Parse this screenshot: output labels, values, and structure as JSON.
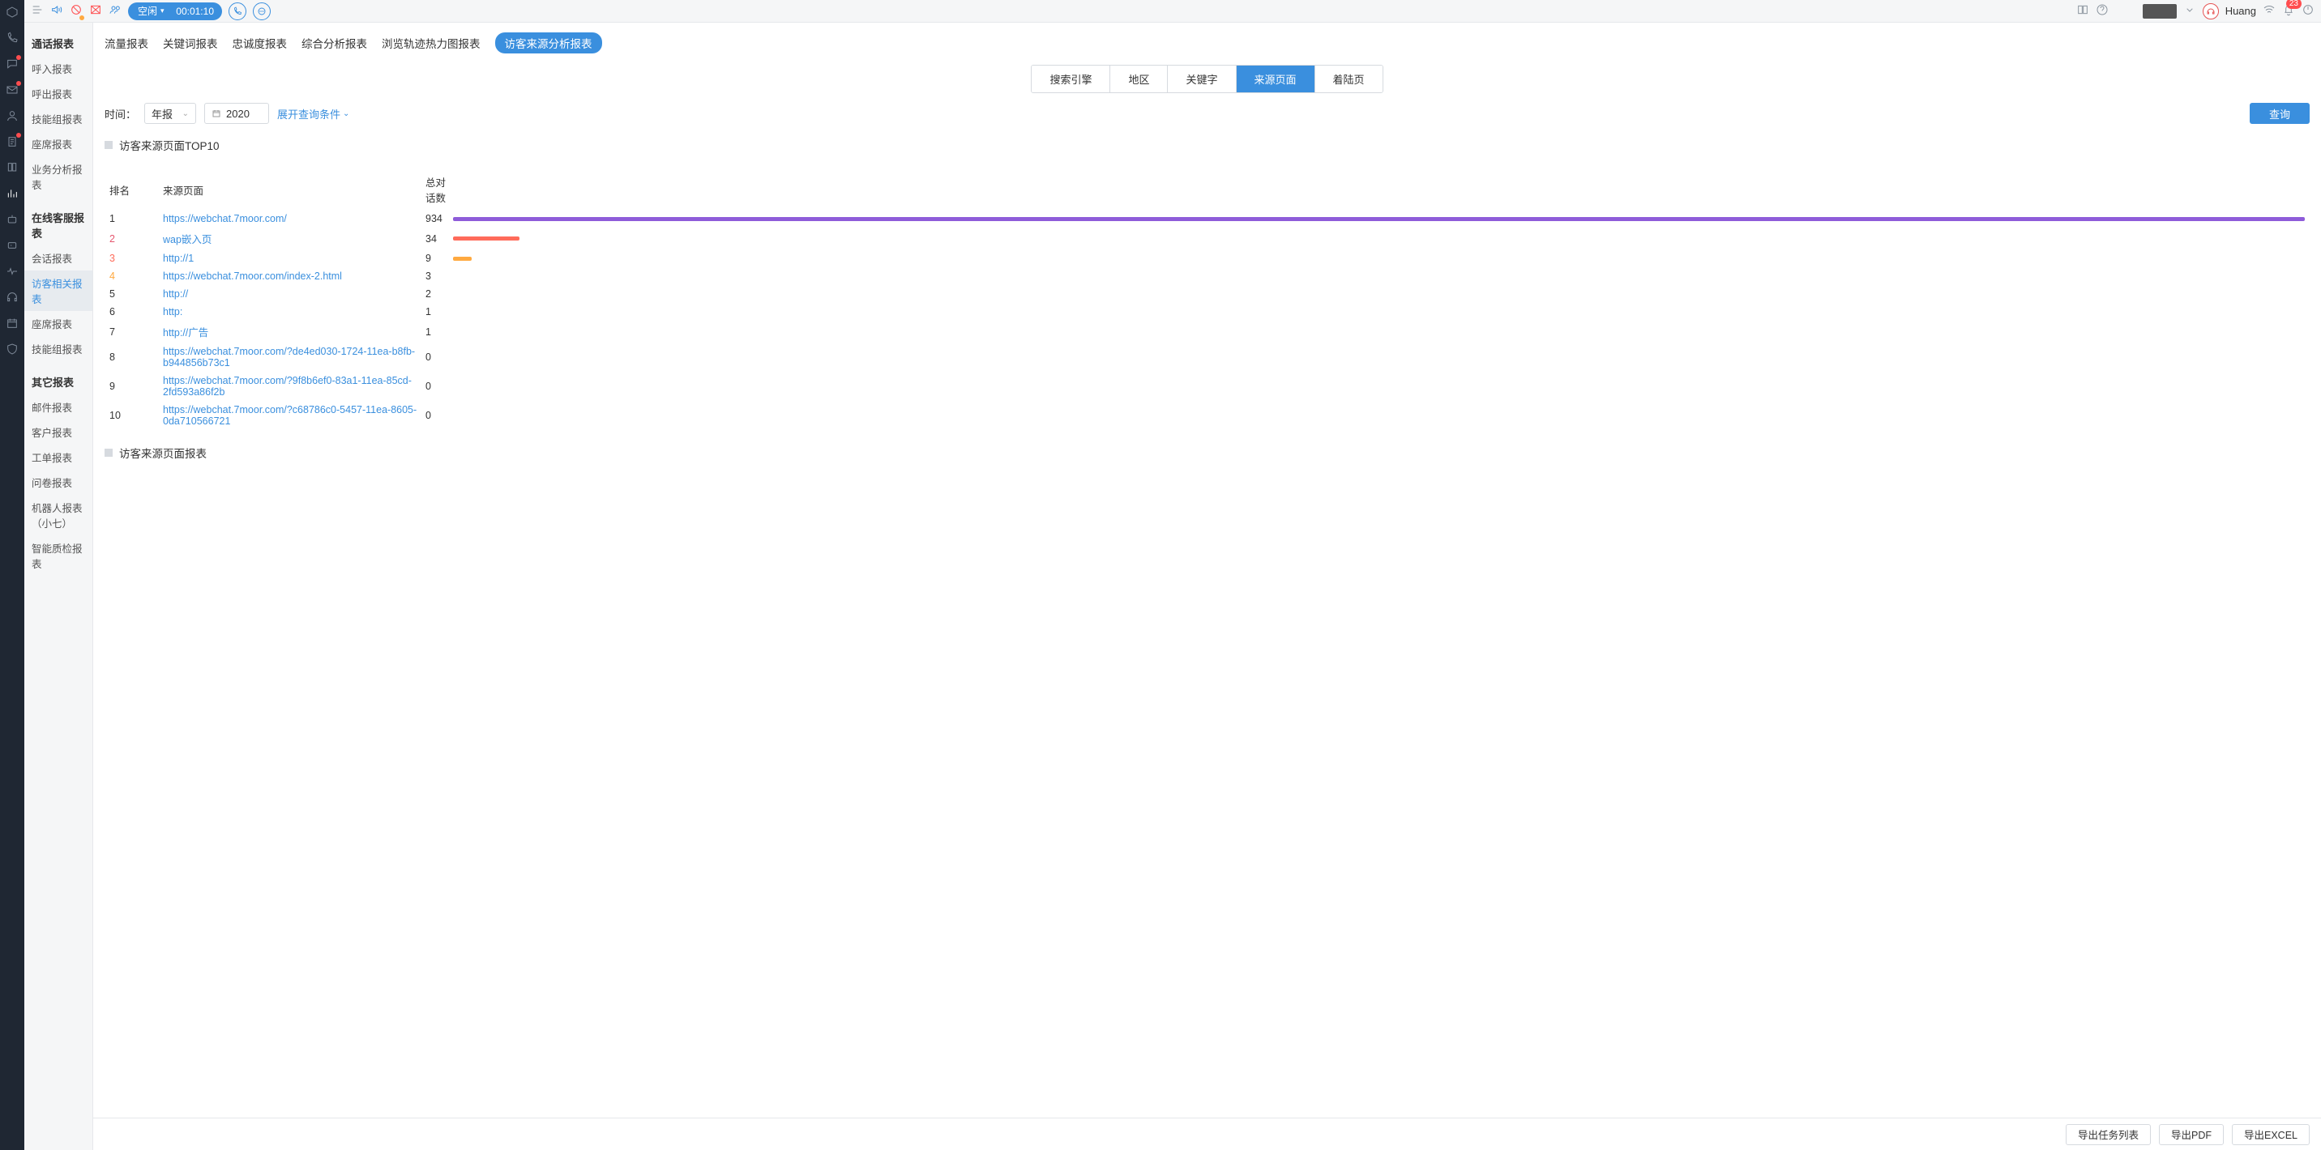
{
  "top": {
    "status": "空闲",
    "timer": "00:01:10",
    "user": "Huang",
    "notif_count": "23"
  },
  "sidebar": {
    "g1": {
      "title": "通话报表",
      "items": [
        "呼入报表",
        "呼出报表",
        "技能组报表",
        "座席报表",
        "业务分析报表"
      ]
    },
    "g2": {
      "title": "在线客服报表",
      "items": [
        "会话报表",
        "访客相关报表",
        "座席报表",
        "技能组报表"
      ]
    },
    "g3": {
      "title": "其它报表",
      "items": [
        "邮件报表",
        "客户报表",
        "工单报表",
        "问卷报表",
        "机器人报表（小七）",
        "智能质检报表"
      ]
    }
  },
  "tabs1": [
    "流量报表",
    "关键词报表",
    "忠诚度报表",
    "综合分析报表",
    "浏览轨迹热力图报表",
    "访客来源分析报表"
  ],
  "tabs2": [
    "搜索引擎",
    "地区",
    "关键字",
    "来源页面",
    "着陆页"
  ],
  "filter": {
    "label": "时间：",
    "period": "年报",
    "year": "2020",
    "expand": "展开查询条件",
    "query": "查询"
  },
  "section1": "访客来源页面TOP10",
  "section2": "访客来源页面报表",
  "table": {
    "h_rank": "排名",
    "h_page": "来源页面",
    "h_count": "总对话数",
    "rows": [
      {
        "rank": "1",
        "page": "https://webchat.7moor.com/",
        "count": "934",
        "w": 100,
        "cls": "c1"
      },
      {
        "rank": "2",
        "page": "wap嵌入页",
        "count": "34",
        "w": 3.6,
        "cls": "c2"
      },
      {
        "rank": "3",
        "page": "http://1",
        "count": "9",
        "w": 1.0,
        "cls": "c3"
      },
      {
        "rank": "4",
        "page": "https://webchat.7moor.com/index-2.html",
        "count": "3",
        "w": 0,
        "cls": ""
      },
      {
        "rank": "5",
        "page": "http://",
        "count": "2",
        "w": 0,
        "cls": ""
      },
      {
        "rank": "6",
        "page": "http:",
        "count": "1",
        "w": 0,
        "cls": ""
      },
      {
        "rank": "7",
        "page": "http://广告",
        "count": "1",
        "w": 0,
        "cls": ""
      },
      {
        "rank": "8",
        "page": "https://webchat.7moor.com/?de4ed030-1724-11ea-b8fb-b944856b73c1",
        "count": "0",
        "w": 0,
        "cls": ""
      },
      {
        "rank": "9",
        "page": "https://webchat.7moor.com/?9f8b6ef0-83a1-11ea-85cd-2fd593a86f2b",
        "count": "0",
        "w": 0,
        "cls": ""
      },
      {
        "rank": "10",
        "page": "https://webchat.7moor.com/?c68786c0-5457-11ea-8605-0da710566721",
        "count": "0",
        "w": 0,
        "cls": ""
      }
    ]
  },
  "export": {
    "tasks": "导出任务列表",
    "pdf": "导出PDF",
    "excel": "导出EXCEL"
  },
  "chart_data": {
    "type": "bar",
    "title": "访客来源页面TOP10",
    "categories": [
      "https://webchat.7moor.com/",
      "wap嵌入页",
      "http://1",
      "https://webchat.7moor.com/index-2.html",
      "http://",
      "http:",
      "http://广告",
      "https://webchat.7moor.com/?de4ed030-1724-11ea-b8fb-b944856b73c1",
      "https://webchat.7moor.com/?9f8b6ef0-83a1-11ea-85cd-2fd593a86f2b",
      "https://webchat.7moor.com/?c68786c0-5457-11ea-8605-0da710566721"
    ],
    "values": [
      934,
      34,
      9,
      3,
      2,
      1,
      1,
      0,
      0,
      0
    ],
    "xlabel": "总对话数",
    "ylabel": "来源页面",
    "ylim": [
      0,
      934
    ]
  }
}
